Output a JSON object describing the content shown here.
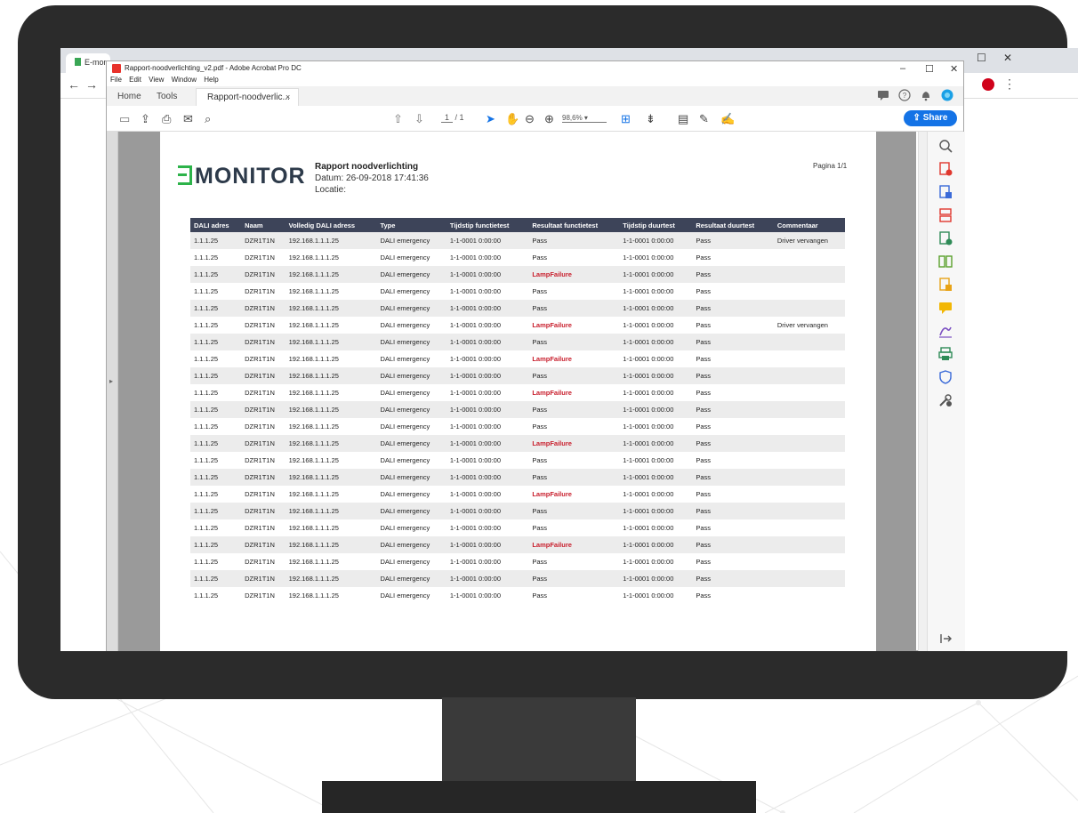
{
  "chrome": {
    "tab_label": "E-mon"
  },
  "acrobat": {
    "window_title": "Rapport-noodverlichting_v2.pdf - Adobe Acrobat Pro DC",
    "menu": [
      "File",
      "Edit",
      "View",
      "Window",
      "Help"
    ],
    "tabs": {
      "home": "Home",
      "tools": "Tools",
      "document": "Rapport-noodverlic...",
      "close": "×"
    },
    "toolbar": {
      "page_current": "1",
      "page_total": "/ 1",
      "zoom": "98,6%"
    },
    "share_label": "Share"
  },
  "report": {
    "logo": "MONITOR",
    "title": "Rapport noodverlichting",
    "date": "Datum: 26-09-2018 17:41:36",
    "location": "Locatie:",
    "page": "Pagina 1/1",
    "columns": [
      "DALI adres",
      "Naam",
      "Volledig DALI adress",
      "Type",
      "Tijdstip functietest",
      "Resultaat functietest",
      "Tijdstip duurtest",
      "Resultaat duurtest",
      "Commentaar"
    ],
    "rows": [
      [
        "1.1.1.25",
        "DZR1T1N",
        "192.168.1.1.1.25",
        "DALI emergency",
        "1-1-0001 0:00:00",
        "Pass",
        "1-1-0001 0:00:00",
        "Pass",
        "Driver vervangen"
      ],
      [
        "1.1.1.25",
        "DZR1T1N",
        "192.168.1.1.1.25",
        "DALI emergency",
        "1-1-0001 0:00:00",
        "Pass",
        "1-1-0001 0:00:00",
        "Pass",
        ""
      ],
      [
        "1.1.1.25",
        "DZR1T1N",
        "192.168.1.1.1.25",
        "DALI emergency",
        "1-1-0001 0:00:00",
        "LampFailure",
        "1-1-0001 0:00:00",
        "Pass",
        ""
      ],
      [
        "1.1.1.25",
        "DZR1T1N",
        "192.168.1.1.1.25",
        "DALI emergency",
        "1-1-0001 0:00:00",
        "Pass",
        "1-1-0001 0:00:00",
        "Pass",
        ""
      ],
      [
        "1.1.1.25",
        "DZR1T1N",
        "192.168.1.1.1.25",
        "DALI emergency",
        "1-1-0001 0:00:00",
        "Pass",
        "1-1-0001 0:00:00",
        "Pass",
        ""
      ],
      [
        "1.1.1.25",
        "DZR1T1N",
        "192.168.1.1.1.25",
        "DALI emergency",
        "1-1-0001 0:00:00",
        "LampFailure",
        "1-1-0001 0:00:00",
        "Pass",
        "Driver vervangen"
      ],
      [
        "1.1.1.25",
        "DZR1T1N",
        "192.168.1.1.1.25",
        "DALI emergency",
        "1-1-0001 0:00:00",
        "Pass",
        "1-1-0001 0:00:00",
        "Pass",
        ""
      ],
      [
        "1.1.1.25",
        "DZR1T1N",
        "192.168.1.1.1.25",
        "DALI emergency",
        "1-1-0001 0:00:00",
        "LampFailure",
        "1-1-0001 0:00:00",
        "Pass",
        ""
      ],
      [
        "1.1.1.25",
        "DZR1T1N",
        "192.168.1.1.1.25",
        "DALI emergency",
        "1-1-0001 0:00:00",
        "Pass",
        "1-1-0001 0:00:00",
        "Pass",
        ""
      ],
      [
        "1.1.1.25",
        "DZR1T1N",
        "192.168.1.1.1.25",
        "DALI emergency",
        "1-1-0001 0:00:00",
        "LampFailure",
        "1-1-0001 0:00:00",
        "Pass",
        ""
      ],
      [
        "1.1.1.25",
        "DZR1T1N",
        "192.168.1.1.1.25",
        "DALI emergency",
        "1-1-0001 0:00:00",
        "Pass",
        "1-1-0001 0:00:00",
        "Pass",
        ""
      ],
      [
        "1.1.1.25",
        "DZR1T1N",
        "192.168.1.1.1.25",
        "DALI emergency",
        "1-1-0001 0:00:00",
        "Pass",
        "1-1-0001 0:00:00",
        "Pass",
        ""
      ],
      [
        "1.1.1.25",
        "DZR1T1N",
        "192.168.1.1.1.25",
        "DALI emergency",
        "1-1-0001 0:00:00",
        "LampFailure",
        "1-1-0001 0:00:00",
        "Pass",
        ""
      ],
      [
        "1.1.1.25",
        "DZR1T1N",
        "192.168.1.1.1.25",
        "DALI emergency",
        "1-1-0001 0:00:00",
        "Pass",
        "1-1-0001 0:00:00",
        "Pass",
        ""
      ],
      [
        "1.1.1.25",
        "DZR1T1N",
        "192.168.1.1.1.25",
        "DALI emergency",
        "1-1-0001 0:00:00",
        "Pass",
        "1-1-0001 0:00:00",
        "Pass",
        ""
      ],
      [
        "1.1.1.25",
        "DZR1T1N",
        "192.168.1.1.1.25",
        "DALI emergency",
        "1-1-0001 0:00:00",
        "LampFailure",
        "1-1-0001 0:00:00",
        "Pass",
        ""
      ],
      [
        "1.1.1.25",
        "DZR1T1N",
        "192.168.1.1.1.25",
        "DALI emergency",
        "1-1-0001 0:00:00",
        "Pass",
        "1-1-0001 0:00:00",
        "Pass",
        ""
      ],
      [
        "1.1.1.25",
        "DZR1T1N",
        "192.168.1.1.1.25",
        "DALI emergency",
        "1-1-0001 0:00:00",
        "Pass",
        "1-1-0001 0:00:00",
        "Pass",
        ""
      ],
      [
        "1.1.1.25",
        "DZR1T1N",
        "192.168.1.1.1.25",
        "DALI emergency",
        "1-1-0001 0:00:00",
        "LampFailure",
        "1-1-0001 0:00:00",
        "Pass",
        ""
      ],
      [
        "1.1.1.25",
        "DZR1T1N",
        "192.168.1.1.1.25",
        "DALI emergency",
        "1-1-0001 0:00:00",
        "Pass",
        "1-1-0001 0:00:00",
        "Pass",
        ""
      ],
      [
        "1.1.1.25",
        "DZR1T1N",
        "192.168.1.1.1.25",
        "DALI emergency",
        "1-1-0001 0:00:00",
        "Pass",
        "1-1-0001 0:00:00",
        "Pass",
        ""
      ],
      [
        "1.1.1.25",
        "DZR1T1N",
        "192.168.1.1.1.25",
        "DALI emergency",
        "1-1-0001 0:00:00",
        "Pass",
        "1-1-0001 0:00:00",
        "Pass",
        ""
      ]
    ]
  },
  "colors": {
    "share_blue": "#1473e6",
    "table_header": "#3d4459",
    "fail_red": "#c81e2c",
    "logo_green": "#2db34a",
    "bezel": "#2b2b2b"
  },
  "icons": {
    "toolbar": [
      "save-icon",
      "upload-icon",
      "print-icon",
      "email-icon",
      "search-icon",
      "prev-page-icon",
      "next-page-icon",
      "select-cursor-icon",
      "hand-icon",
      "zoom-out-icon",
      "zoom-in-icon",
      "fit-page-icon",
      "scroll-mode-icon",
      "comment-icon",
      "highlight-icon",
      "sign-icon"
    ],
    "right_pane": [
      "zoom-tool-icon",
      "create-pdf-icon",
      "export-pdf-icon",
      "organize-pages-icon",
      "edit-pdf-icon",
      "compare-icon",
      "combine-icon",
      "comment-pane-icon",
      "fill-sign-icon",
      "print-production-icon",
      "protect-icon",
      "more-tools-icon",
      "collapse-pane-icon"
    ]
  }
}
